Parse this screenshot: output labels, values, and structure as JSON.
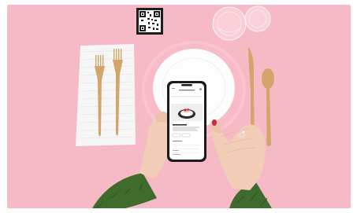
{
  "scene": {
    "background_color": "#f6b9c6",
    "napkin_color": "#f6f6f6",
    "gold_color": "#d2a56a",
    "plate_pink_color": "#f9c4cf",
    "plate_white_color": "#fdfdfd",
    "sleeve_color": "#3f6b2d",
    "skin_color": "#f2cdb7",
    "nail_color": "#c9264b"
  },
  "qr_code": {
    "label": "qr-code"
  },
  "phone": {
    "header": "",
    "dish_name": "",
    "description": "",
    "tags": [],
    "quantity_label": "",
    "rows": []
  }
}
